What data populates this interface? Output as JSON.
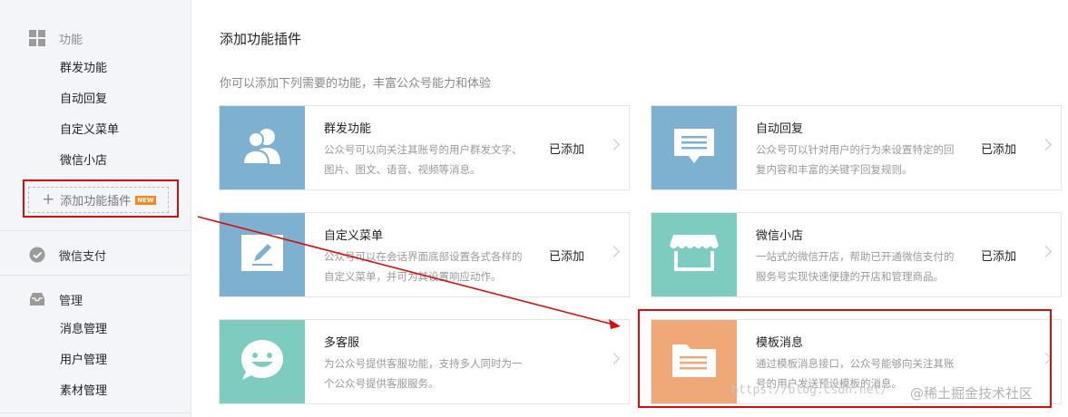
{
  "sidebar": {
    "function_section": {
      "label": "功能",
      "icon": "grid-icon",
      "items": [
        "群发功能",
        "自动回复",
        "自定义菜单",
        "微信小店"
      ]
    },
    "add_plugin": {
      "label": "添加功能插件",
      "badge": "NEW"
    },
    "wechat_pay": {
      "label": "微信支付",
      "icon": "wechat-pay-icon"
    },
    "manage_section": {
      "label": "管理",
      "icon": "inbox-icon",
      "items": [
        "消息管理",
        "用户管理",
        "素材管理"
      ]
    }
  },
  "main": {
    "title": "添加功能插件",
    "description": "你可以添加下列需要的功能，丰富公众号能力和体验",
    "cards": [
      {
        "title": "群发功能",
        "desc_lines": [
          "公众号可以向关注其账号的用户群发文字、",
          "图片、图文、语音、视频等消息。"
        ],
        "status": "已添加",
        "icon": "users-icon",
        "color": "#7eb0cf"
      },
      {
        "title": "自动回复",
        "desc_lines": [
          "公众号可以针对用户的行为来设置特定的回",
          "复内容和丰富的关键字回复规则。"
        ],
        "status": "已添加",
        "icon": "chat-bubble-icon",
        "color": "#7eb0cf"
      },
      {
        "title": "自定义菜单",
        "desc_lines": [
          "公众号可以在会话界面底部设置各式各样的",
          "自定义菜单，并可为其设置响应动作。"
        ],
        "status": "已添加",
        "icon": "pencil-icon",
        "color": "#7eb0cf"
      },
      {
        "title": "微信小店",
        "desc_lines": [
          "一站式的微信开店，帮助已开通微信支付的",
          "服务号实现快速便捷的开店和管理商品。"
        ],
        "status": "已添加",
        "icon": "storefront-icon",
        "color": "#7ecbc0"
      },
      {
        "title": "多客服",
        "desc_lines": [
          "为公众号提供客服功能，支持多人同时为一",
          "个公众号提供客服服务。"
        ],
        "status": "",
        "icon": "smile-bubble-icon",
        "color": "#7ecbc0"
      },
      {
        "title": "模板消息",
        "desc_lines": [
          "通过模板消息接口，公众号能够向关注其账",
          "号的用户发送预设模板的消息。"
        ],
        "status": "",
        "icon": "folder-icon",
        "color": "#f0a878"
      }
    ]
  },
  "watermark": {
    "url": "https://blog.csdn.net/",
    "site": "@稀土掘金技术社区"
  },
  "colors": {
    "highlight": "#d20f0f",
    "sidebar_bg": "#f4f5f9",
    "new_badge": "#f08a24"
  }
}
